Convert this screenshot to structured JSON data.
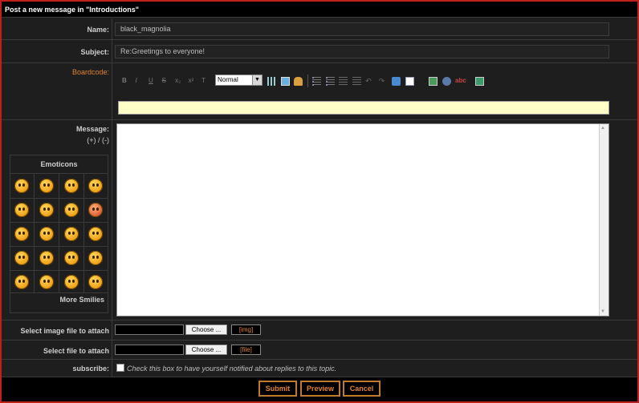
{
  "title": "Post a new message in \"Introductions\"",
  "name": {
    "label": "Name:",
    "value": "black_magnolia"
  },
  "subject": {
    "label": "Subject:",
    "value": "Re:Greetings to everyone!"
  },
  "boardcode": {
    "label": "Boardcode:",
    "size_value": "Normal"
  },
  "message": {
    "label": "Message:",
    "resize": "(+) / (-)"
  },
  "emoticons": {
    "title": "Emoticons",
    "more": "More Smilies"
  },
  "image_attach": {
    "label": "Select image file to attach",
    "choose": "Choose ...",
    "tag": "[img]"
  },
  "file_attach": {
    "label": "Select file to attach",
    "choose": "Choose ...",
    "tag": "[file]"
  },
  "subscribe": {
    "label": "subscribe:",
    "text": "Check this box to have yourself notified about replies to this topic."
  },
  "buttons": {
    "submit": "Submit",
    "preview": "Preview",
    "cancel": "Cancel"
  },
  "colors": {
    "accent": "#e0822c",
    "frame": "#c0201c",
    "helpline": "#ffffc8"
  }
}
